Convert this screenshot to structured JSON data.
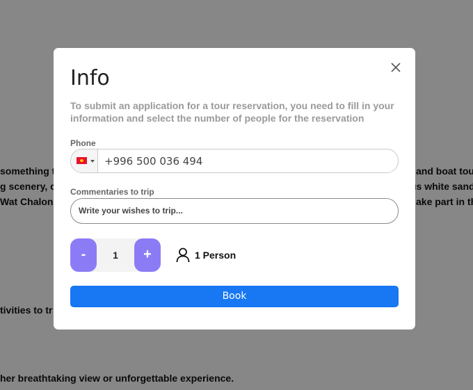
{
  "background": {
    "line1_left": "something t",
    "line2_left": "g scenery, c",
    "line3_left": "Wat Chalong",
    "line1_right": "and boat tou",
    "line2_right": "us white sand",
    "line3_right": "ake part in th",
    "line4_left": "tivities to tr",
    "line5_left": "her breathtaking view or unforgettable experience."
  },
  "modal": {
    "title": "Info",
    "subtitle": "To submit an application for a tour reservation, you need to fill in your information and select the number of people for the reservation",
    "phone_label": "Phone",
    "phone_value": "+996 500 036 494",
    "comment_label": "Commentaries to trip",
    "comment_placeholder": "Write your wishes to trip...",
    "minus_label": "-",
    "plus_label": "+",
    "count": "1",
    "person_text": "1 Person",
    "book_label": "Book"
  },
  "colors": {
    "accent": "#1877f2",
    "stepper": "#8b7cf6"
  },
  "icons": {
    "close": "close-icon",
    "person": "person-icon",
    "flag": "kyrgyzstan-flag-icon"
  }
}
